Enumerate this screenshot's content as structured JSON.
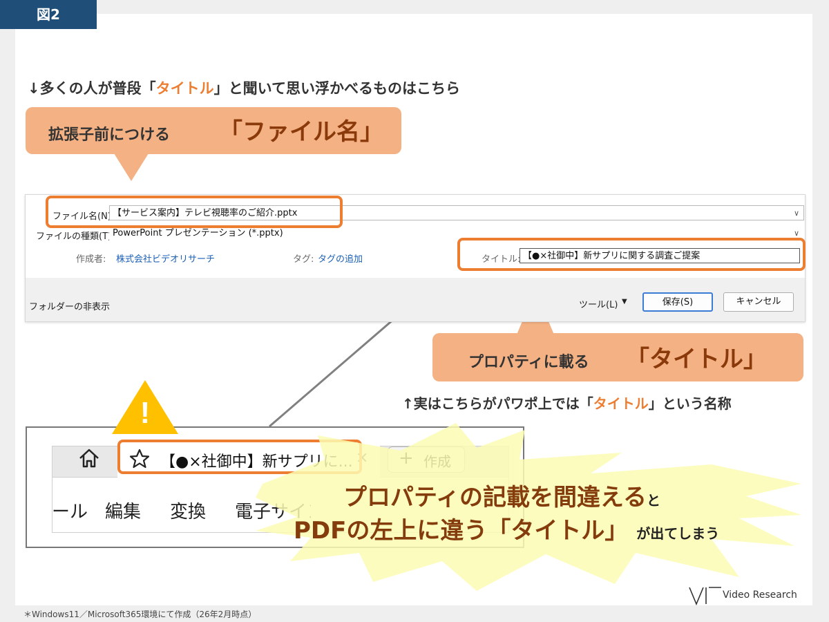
{
  "figure_label": "図2",
  "top_note": {
    "arrow": "↓",
    "pre": "多くの人が普段「",
    "emph": "タイトル",
    "post": "」と聞いて思い浮かべるものはこちら"
  },
  "callout_filename": {
    "pre": "拡張子前につける",
    "big": "「ファイル名」"
  },
  "dialog": {
    "filename_label": "ファイル名(N):",
    "filename_value": "【サービス案内】テレビ視聴率のご紹介.pptx",
    "filetype_label": "ファイルの種類(T):",
    "filetype_value": "PowerPoint プレゼンテーション (*.pptx)",
    "author_label": "作成者:",
    "author_value": "株式会社ビデオリサーチ",
    "tag_label": "タグ:",
    "tag_value": "タグの追加",
    "title_label": "タイトル:",
    "title_value": "【●×社御中】新サプリに関する調査ご提案",
    "hide_folders": "フォルダーの非表示",
    "tools_label": "ツール(L)",
    "tools_arrow": "▼",
    "save_label": "保存(S)",
    "cancel_label": "キャンセル",
    "dropdown_chevron": "∨"
  },
  "callout_title": {
    "pre": "プロパティに載る",
    "big": "「タイトル」"
  },
  "bottom_note": {
    "arrow": "↑",
    "pre": "実はこちらがパワポ上では「",
    "emph": "タイトル",
    "post": "」という名称"
  },
  "warning": {
    "symbol": "!"
  },
  "browser": {
    "tab_title": "【●×社御中】新サプリに...",
    "tab_close": "×",
    "create_plus": "+",
    "create_label": "作成",
    "menu": [
      "ール",
      "編集",
      "変換",
      "電子サイン"
    ]
  },
  "burst": {
    "line1_main": "プロパティの記載を間違える",
    "line1_small": "と",
    "line2_main": "PDFの左上に違う「タイトル」",
    "line2_small": "が出てしまう"
  },
  "footnote": "＊Windows11／Microsoft365環境にて作成（26年2月時点）",
  "logo": "Video Research",
  "colors": {
    "accent": "#ed7d31",
    "callout": "#f4b183",
    "figure_label": "#1f4e79",
    "burst": "#fdfbb4"
  }
}
